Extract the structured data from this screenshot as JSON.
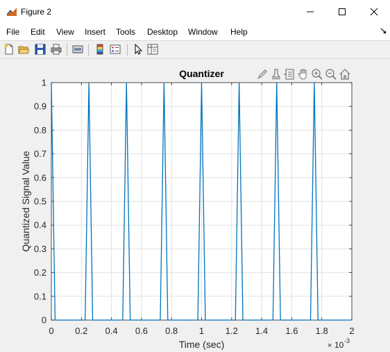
{
  "window": {
    "title": "Figure 2"
  },
  "menu": [
    "File",
    "Edit",
    "View",
    "Insert",
    "Tools",
    "Desktop",
    "Window",
    "Help"
  ],
  "toolbar": {
    "icons": [
      "new-figure-icon",
      "open-file-icon",
      "save-icon",
      "print-icon",
      "link-plot-icon",
      "colorbar-icon",
      "legend-icon",
      "edit-plot-icon",
      "property-inspector-icon"
    ]
  },
  "axes_toolbar": {
    "icons": [
      "brush-icon",
      "data-tips-icon",
      "restore-view-icon",
      "pan-icon",
      "zoom-in-icon",
      "zoom-out-icon",
      "home-icon"
    ]
  },
  "chart_data": {
    "type": "line",
    "title": "Quantizer",
    "xlabel": "Time (sec)",
    "ylabel": "Quantized Signal Value",
    "x_exponent_label": "10",
    "x_exponent": "-3",
    "xlim": [
      0,
      2
    ],
    "ylim": [
      0,
      1
    ],
    "xticks": [
      "0",
      "0.2",
      "0.4",
      "0.6",
      "0.8",
      "1",
      "1.2",
      "1.4",
      "1.6",
      "1.8",
      "2"
    ],
    "yticks": [
      "0",
      "0.1",
      "0.2",
      "0.3",
      "0.4",
      "0.5",
      "0.6",
      "0.7",
      "0.8",
      "0.9",
      "1"
    ],
    "grid": true,
    "series_color": "#0072bd",
    "series": [
      {
        "x": [
          0,
          0.025,
          0.225,
          0.25,
          0.275,
          0.475,
          0.5,
          0.525,
          0.725,
          0.75,
          0.775,
          0.975,
          1.0,
          1.025,
          1.225,
          1.25,
          1.275,
          1.475,
          1.5,
          1.525,
          1.725,
          1.75,
          1.775,
          2.0
        ],
        "y": [
          1,
          0,
          0,
          1,
          0,
          0,
          1,
          0,
          0,
          1,
          0,
          0,
          1,
          0,
          0,
          1,
          0,
          0,
          1,
          0,
          0,
          1,
          0,
          0
        ]
      }
    ]
  }
}
